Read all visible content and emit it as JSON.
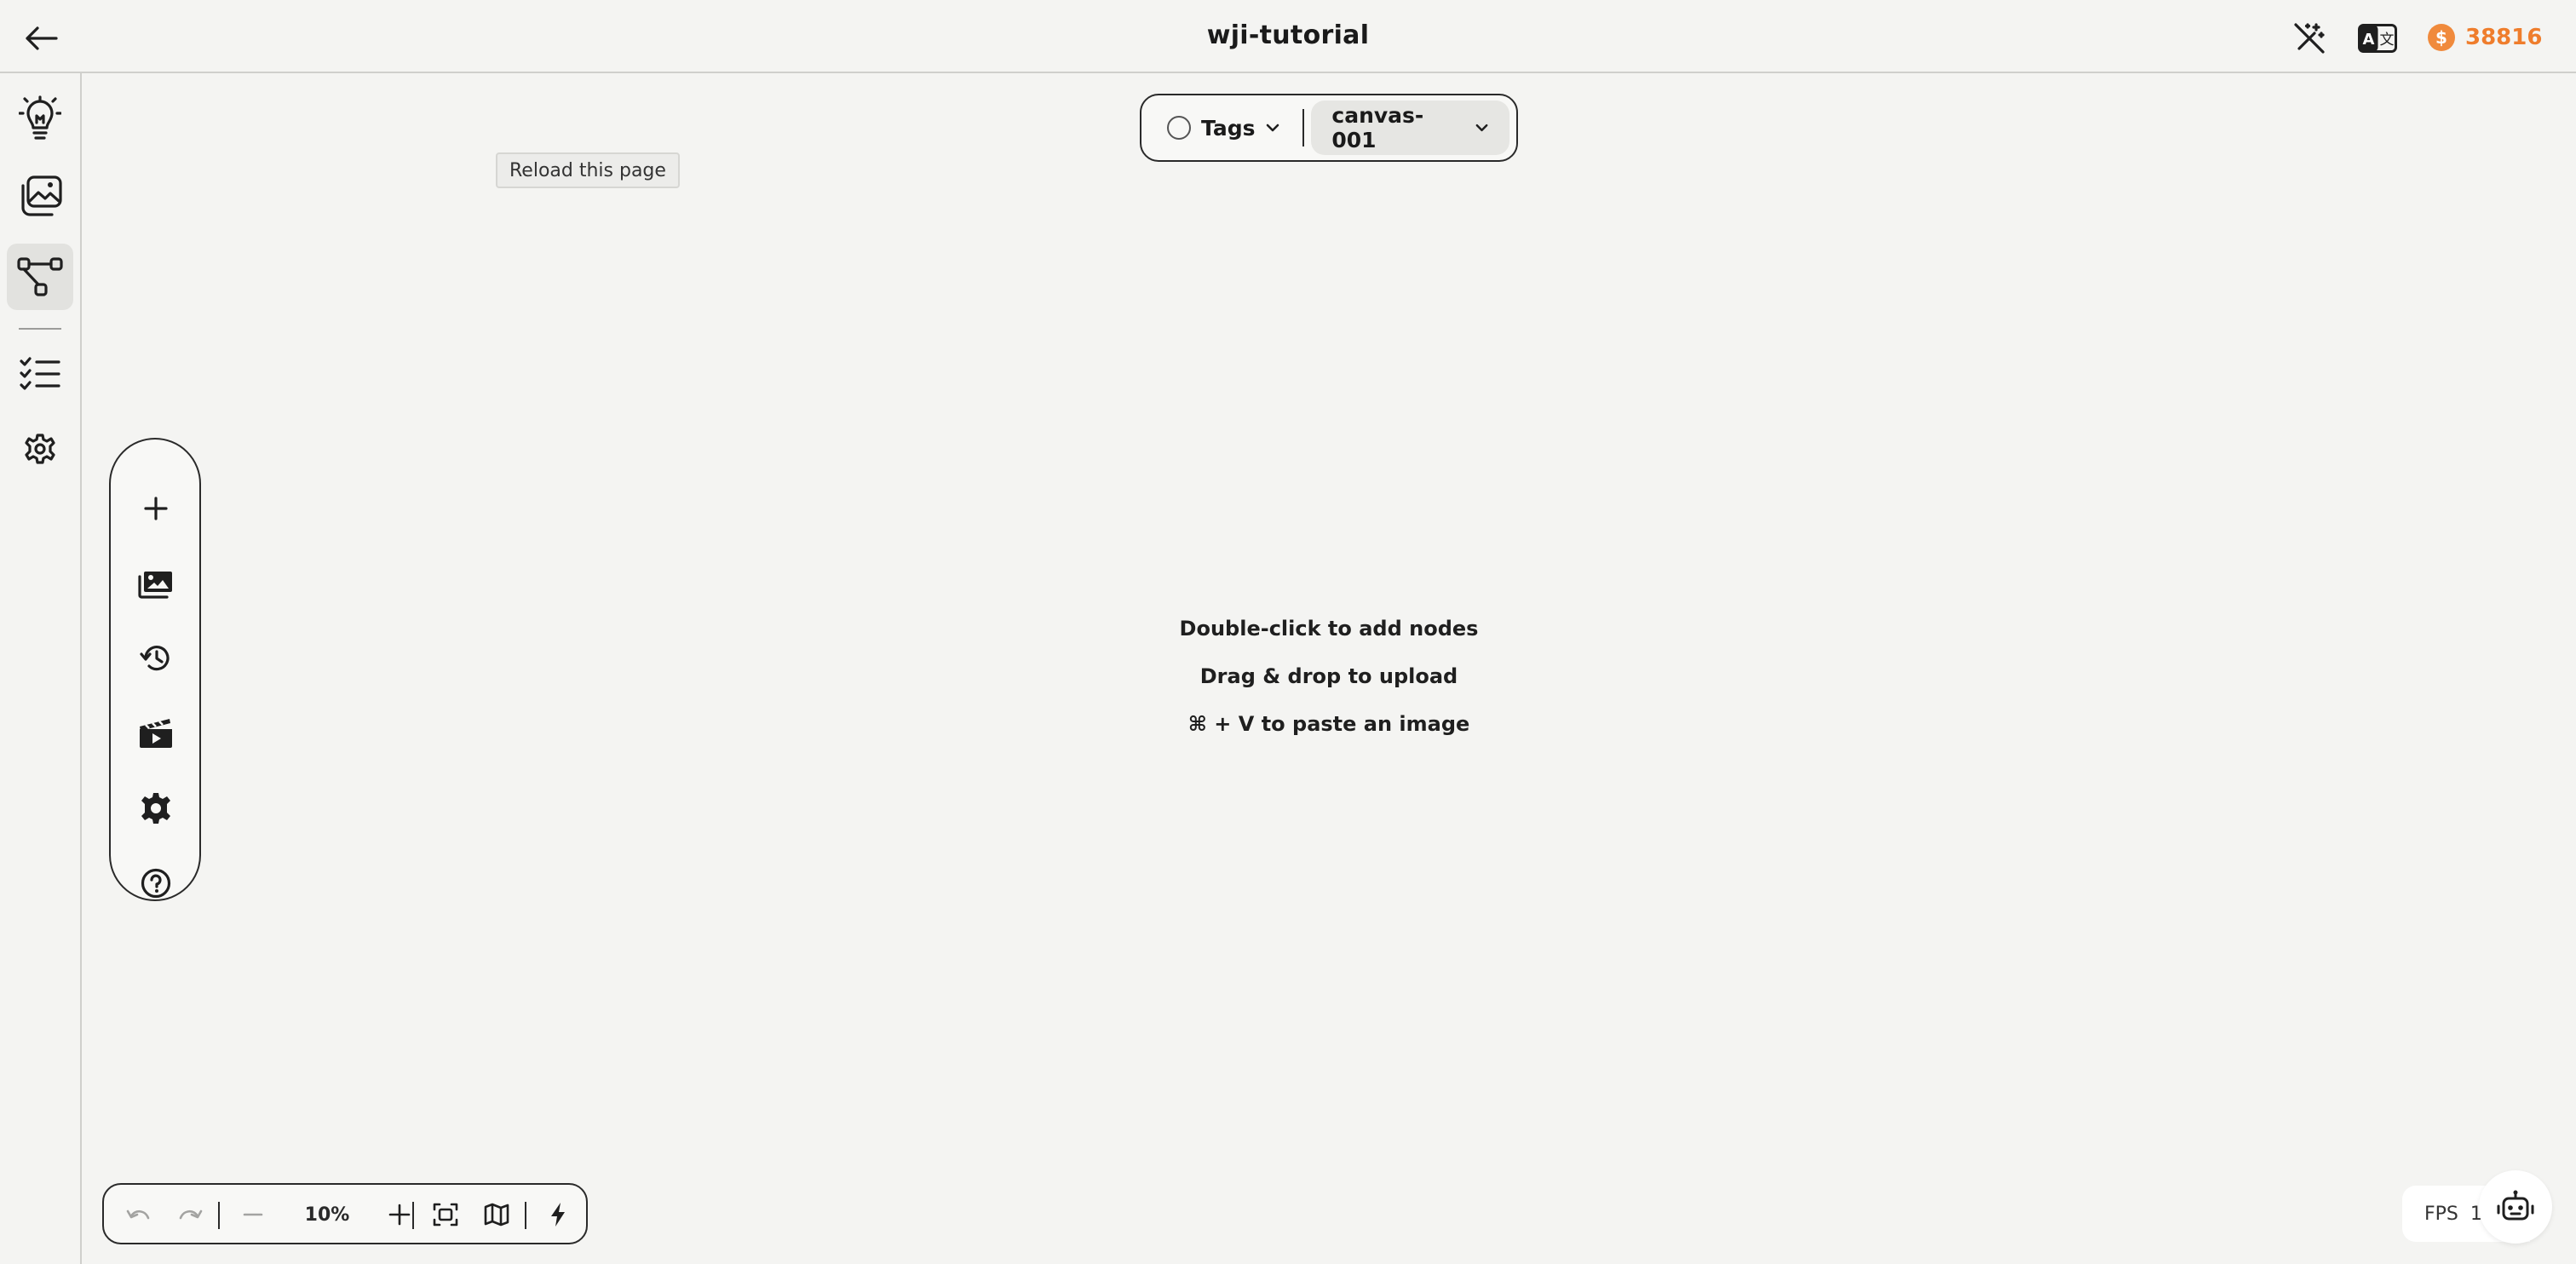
{
  "header": {
    "title": "wji-tutorial",
    "credits": "38816",
    "coin_symbol": "$",
    "accent_color": "#ef7d2c"
  },
  "rail": {
    "items": [
      {
        "icon": "lightbulb-icon"
      },
      {
        "icon": "image-gallery-icon"
      },
      {
        "icon": "workflow-icon",
        "active": true
      },
      {
        "icon": "checklist-icon"
      },
      {
        "icon": "gear-icon"
      }
    ]
  },
  "tag_bar": {
    "tags_label": "Tags",
    "canvas_label": "canvas-001"
  },
  "tooltip": {
    "text": "Reload this page"
  },
  "float_toolbar": {
    "items": [
      "plus-icon",
      "images-icon",
      "history-icon",
      "clapperboard-icon",
      "gear-icon",
      "help-icon"
    ]
  },
  "empty_state": {
    "line1": "Double-click to add nodes",
    "line2": "Drag & drop to upload",
    "line3": "⌘ + V to paste an image"
  },
  "zoom_bar": {
    "zoom": "10%"
  },
  "status": {
    "fps_label": "FPS",
    "fps_value": "1."
  }
}
